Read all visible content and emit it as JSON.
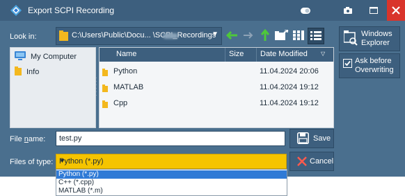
{
  "window": {
    "title": "Export SCPI Recording"
  },
  "toolbar": {
    "look_in_label": "Look in:",
    "path": "C:\\Users\\Public\\Docu...      \\SCPI_Recordings"
  },
  "sidebar": {
    "items": [
      {
        "label": "My Computer"
      },
      {
        "label": "Info"
      }
    ]
  },
  "file_list": {
    "columns": [
      "Name",
      "Size",
      "Date Modified"
    ],
    "rows": [
      {
        "name": "Python",
        "size": "",
        "date": "11.04.2024 20:06"
      },
      {
        "name": "MATLAB",
        "size": "",
        "date": "11.04.2024 19:12"
      },
      {
        "name": "Cpp",
        "size": "",
        "date": "11.04.2024 19:12"
      }
    ]
  },
  "right_panel": {
    "windows_explorer_line1": "Windows",
    "windows_explorer_line2": "Explorer",
    "ask_before_line1": "Ask before",
    "ask_before_line2": "Overwriting",
    "ask_before_checked": true
  },
  "file_name": {
    "label_pre": "File ",
    "label_u": "n",
    "label_post": "ame:",
    "value": "test.py"
  },
  "file_type": {
    "label": "Files of type:",
    "selected": "Python (*.py)",
    "options": [
      "Python (*.py)",
      "C++ (*.cpp)",
      "MATLAB (*.m)"
    ]
  },
  "buttons": {
    "save": "Save",
    "cancel": "Cancel"
  },
  "colors": {
    "accent": "#f5c400",
    "titlebar": "#3d5f7e",
    "dialog_bg": "#4a6f8e",
    "close": "#d9342b",
    "selection": "#2f7ad6"
  }
}
